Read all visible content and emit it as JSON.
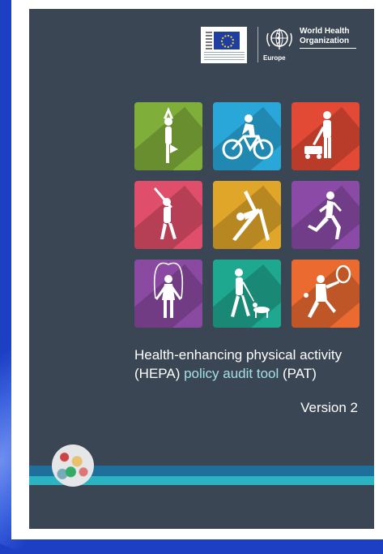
{
  "who": {
    "name_line1": "World Health",
    "name_line2": "Organization",
    "region": "Europe"
  },
  "title": {
    "line1": "Health-enhancing physical activity",
    "line2_pre": "(HEPA) ",
    "line2_highlight": "policy audit tool",
    "line2_post": " (PAT)"
  },
  "version": "Version 2",
  "tiles": [
    {
      "activity": "yoga-tree-pose",
      "color": "#7fae3a"
    },
    {
      "activity": "cycling",
      "color": "#29a7d9"
    },
    {
      "activity": "lawn-mowing",
      "color": "#e24a35"
    },
    {
      "activity": "golf",
      "color": "#df4e6a"
    },
    {
      "activity": "yoga-triangle",
      "color": "#e0a62a"
    },
    {
      "activity": "running",
      "color": "#8a4aa6"
    },
    {
      "activity": "skipping-rope",
      "color": "#8b4aa2"
    },
    {
      "activity": "dog-walking",
      "color": "#1fa890"
    },
    {
      "activity": "tennis",
      "color": "#ea6a30"
    }
  ],
  "colors": {
    "cover": "#3a4654",
    "stripe_dark": "#1f6f9c",
    "stripe_light": "#2bb3c2",
    "title_highlight": "#a3e0e6"
  }
}
